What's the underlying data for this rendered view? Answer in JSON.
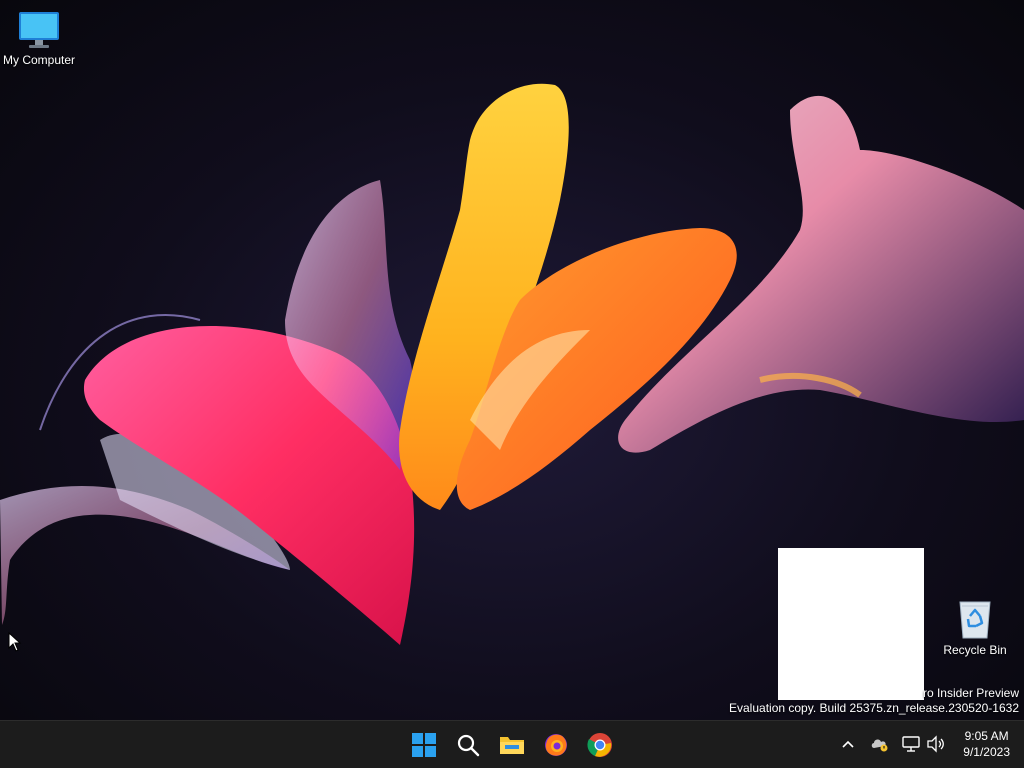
{
  "desktop": {
    "icons": [
      {
        "label": "My Computer",
        "icon": "monitor-icon"
      },
      {
        "label": "Recycle Bin",
        "icon": "recycle-bin-icon"
      }
    ]
  },
  "watermark": {
    "line1": "ro Insider Preview",
    "line2": "Evaluation copy. Build 25375.zn_release.230520-1632"
  },
  "taskbar": {
    "apps": [
      {
        "name": "Start",
        "icon": "windows-start-icon"
      },
      {
        "name": "Search",
        "icon": "search-icon"
      },
      {
        "name": "File Explorer",
        "icon": "folder-icon"
      },
      {
        "name": "Firefox",
        "icon": "firefox-icon"
      },
      {
        "name": "Chrome",
        "icon": "chrome-icon"
      }
    ],
    "tray": [
      {
        "name": "show-hidden-icons",
        "icon": "chevron-up-icon"
      },
      {
        "name": "onedrive",
        "icon": "cloud-warning-icon"
      },
      {
        "name": "network",
        "icon": "network-icon"
      },
      {
        "name": "volume",
        "icon": "speaker-icon"
      }
    ],
    "clock": {
      "time": "9:05 AM",
      "date": "9/1/2023"
    }
  },
  "colors": {
    "taskbar_bg": "#1c1c1c",
    "windows_blue": "#2aa1f0",
    "folder_yellow": "#f5c330"
  }
}
